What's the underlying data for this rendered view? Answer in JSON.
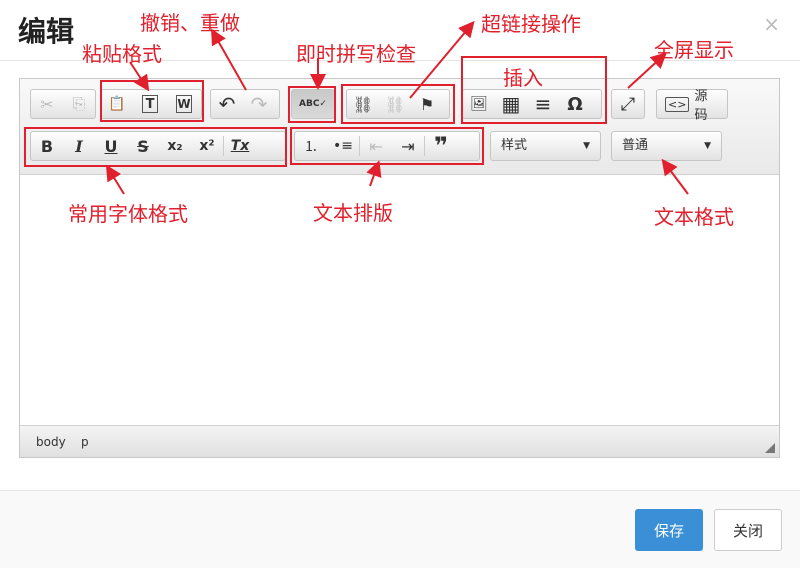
{
  "dialog": {
    "title": "编辑",
    "close_symbol": "×"
  },
  "toolbar": {
    "row1": {
      "cut": "✂",
      "copy": "⎘",
      "paste": "📋",
      "paste_text": "T",
      "paste_word": "W",
      "undo": "↶",
      "redo": "↷",
      "spell": "ABC✓",
      "link": "⛓",
      "unlink": "⛓",
      "anchor": "⚑",
      "image": "🖼",
      "table": "▦",
      "hr": "≡",
      "special_char": "Ω",
      "maximize": "⤢",
      "source_label": "源码"
    },
    "row2": {
      "bold": "B",
      "italic": "I",
      "underline": "U",
      "strike": "S",
      "subscript": "x₂",
      "superscript": "x²",
      "remove_format": "Tx",
      "ordered_list": "⒈",
      "bullet_list": "•≡",
      "outdent": "⇤",
      "indent": "⇥",
      "blockquote": "❞",
      "styles_label": "样式",
      "format_label": "普通",
      "dropdown_arrow": "▼"
    }
  },
  "statusbar": {
    "path1": "body",
    "path2": "p"
  },
  "footer": {
    "save_label": "保存",
    "close_label": "关闭"
  },
  "annotations": {
    "paste_format": "粘贴格式",
    "undo_redo": "撤销、重做",
    "spellcheck": "即时拼写检查",
    "hyperlink": "超链接操作",
    "insert": "插入",
    "fullscreen": "全屏显示",
    "font_format": "常用字体格式",
    "text_layout": "文本排版",
    "text_format": "文本格式"
  },
  "colors": {
    "annotation": "#e0202c",
    "primary": "#3a8fd6"
  }
}
